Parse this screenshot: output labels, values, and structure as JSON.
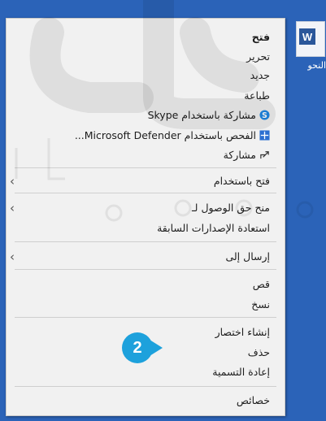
{
  "desktop_file": {
    "caption": "النحو",
    "badge_letter": "W"
  },
  "menu": {
    "open": "فتح",
    "edit": "تحرير",
    "new": "جديد",
    "print": "طباعة",
    "share_skype": "مشاركة باستخدام Skype",
    "scan_defender": "الفحص باستخدام Microsoft Defender...",
    "share": "مشاركة",
    "open_with": "فتح باستخدام",
    "give_access": "منح حق الوصول لـ",
    "restore_versions": "استعادة الإصدارات السابقة",
    "send_to": "إرسال إلى",
    "cut": "قص",
    "copy": "نسخ",
    "create_shortcut": "إنشاء اختصار",
    "delete": "حذف",
    "rename": "إعادة التسمية",
    "properties": "خصائص"
  },
  "callout": {
    "number": "2"
  },
  "icons": [
    "skype-icon",
    "defender-icon",
    "share-icon",
    "chevron-left-icon",
    "word-file-icon"
  ],
  "colors": {
    "desktop_bg": "#2b63b8",
    "menu_bg": "#f1f1f1",
    "callout": "#1da1dc",
    "skype": "#1e88e5",
    "defender": "#2c6fd1"
  }
}
